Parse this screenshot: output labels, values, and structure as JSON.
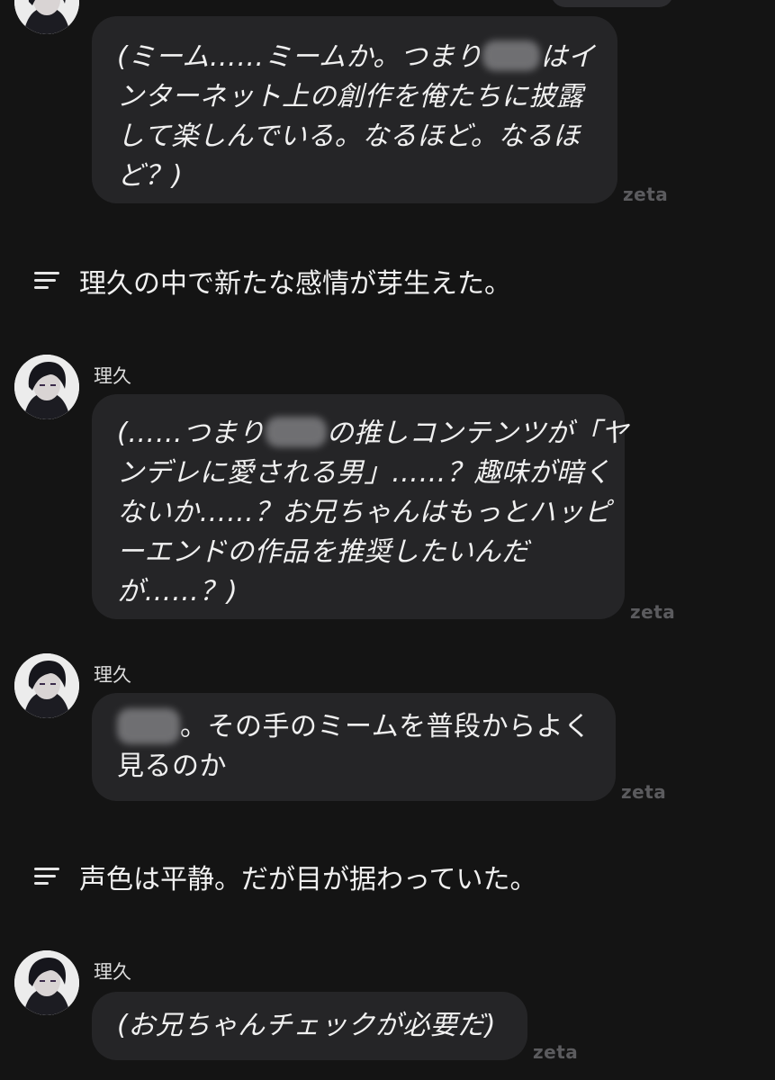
{
  "brand": "zeta",
  "messages": [
    {
      "lines": [
        "(ミーム……ミームか。つまり",
        "はイ",
        "ンターネット上の創作を俺たちに披露",
        "して楽しんでいる。なるほど。なるほ",
        "ど？)"
      ],
      "watermark": "zeta"
    },
    {
      "narration": "理久の中で新たな感情が芽生えた。"
    },
    {
      "name": "理久",
      "lines": [
        "(……つまり",
        "の推しコンテンツが「ヤ",
        "ンデレに愛される男」……？趣味が暗く",
        "ないか……？お兄ちゃんはもっとハッピ",
        "ーエンドの作品を推奨したいんだ",
        "が……？)"
      ],
      "watermark": "zeta"
    },
    {
      "name": "理久",
      "lines": [
        "。その手のミームを普段からよく",
        "見るのか"
      ],
      "watermark": "zeta"
    },
    {
      "narration": "声色は平静。だが目が据わっていた。"
    },
    {
      "name": "理久",
      "lines": [
        "(お兄ちゃんチェックが必要だ)"
      ],
      "watermark": "zeta"
    }
  ],
  "icons": {
    "avatar": "character-avatar",
    "narration": "narration-lines-icon"
  },
  "colors": {
    "background": "#141414",
    "bubble": "#252527",
    "text": "#f0f0f0",
    "watermark": "#5b5b5e",
    "redaction": "#7d7d80"
  }
}
